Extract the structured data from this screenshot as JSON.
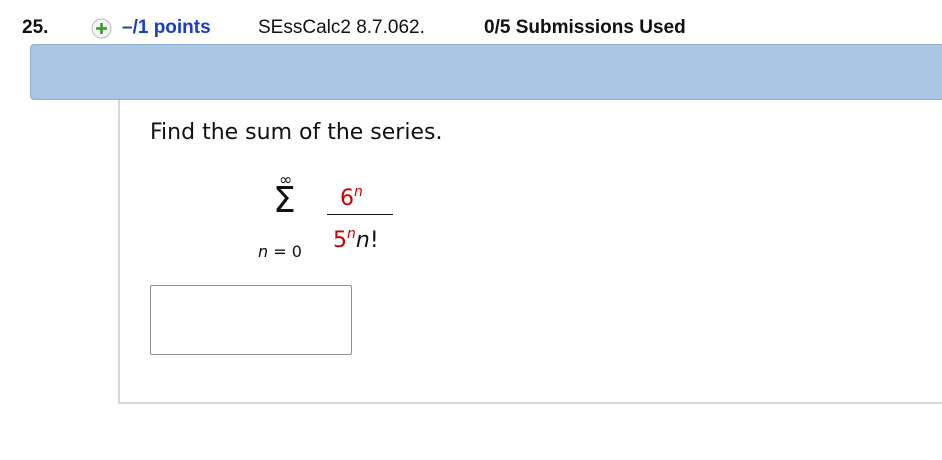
{
  "question": {
    "number": "25.",
    "points_label": "–/1 points",
    "assignment_code": "SEssCalc2 8.7.062.",
    "submissions_label": "0/5 Submissions Used",
    "prompt": "Find the sum of the series.",
    "icon": "plus-circle-icon",
    "icon_color": "#3a9a2e"
  },
  "series": {
    "upper_limit": "∞",
    "sigma": "Σ",
    "lower_var": "n",
    "lower_eq": " = 0",
    "numerator_base": "6",
    "numerator_exp": "n",
    "denominator_base": "5",
    "denominator_exp": "n",
    "denominator_rest": "n",
    "denominator_fact": "!",
    "numerator_color": "#cc0000"
  },
  "answer": {
    "value": "",
    "placeholder": ""
  }
}
